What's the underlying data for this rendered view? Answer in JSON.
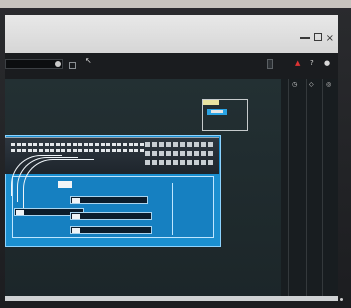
{
  "toolbar": {
    "field_value": "",
    "check_label": "",
    "label_a": "",
    "label_b": "",
    "mode_label": "",
    "btn_label": ""
  },
  "right_panel": {
    "columns": [
      {
        "label": "",
        "icon": "clock-icon"
      },
      {
        "label": "",
        "icon": "chevron-icon"
      },
      {
        "label": "",
        "icon": "help-icon"
      },
      {
        "label": "",
        "icon": "user-icon"
      }
    ]
  },
  "diagram": {
    "nodes": [
      {
        "label": ""
      },
      {
        "label": ""
      },
      {
        "label": ""
      },
      {
        "label": ""
      }
    ],
    "side_label": ""
  },
  "colors": {
    "accent_blue": "#1b8fd0",
    "canvas_bg": "#1f2a2d",
    "titlebar": "#e0e0e0"
  }
}
